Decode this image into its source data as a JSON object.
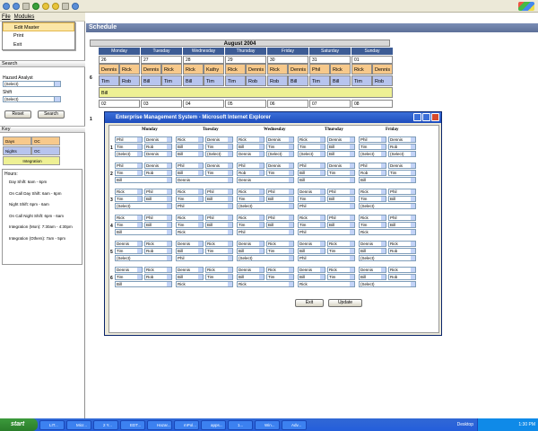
{
  "menu": {
    "file": "File",
    "modules": "Modules",
    "items": [
      "Edit Master",
      "Print",
      "Exit"
    ]
  },
  "search": {
    "section": "Search",
    "hazard_label": "Hazard Analyst",
    "hazard_value": "(Select)",
    "shift_label": "Shift",
    "shift_value": "(Select)",
    "reset": "Reset",
    "search": "Search"
  },
  "key": {
    "section": "Key",
    "rows": [
      {
        "name": "Days",
        "code": "OC"
      },
      {
        "name": "Nights",
        "code": "OC"
      },
      {
        "name": "Integration",
        "code": ""
      }
    ]
  },
  "hours": {
    "title": "Hours:",
    "items": [
      "Day Shift: 6am - 6pm",
      "On Call Day Shift: 6am - 6pm",
      "Night Shift: 6pm - 6am",
      "On Call Night Shift: 6pm - 6am",
      "Integration (Mon): 7:30am - 4:30pm",
      "Integration (Others): 7am - 5pm"
    ]
  },
  "schedule": {
    "title": "Schedule",
    "month": "August 2004",
    "days": [
      "Monday",
      "Tuesday",
      "Wednesday",
      "Thursday",
      "Friday",
      "Saturday",
      "Sunday"
    ],
    "week1_dates": [
      "26",
      "27",
      "28",
      "29",
      "30",
      "31",
      "01"
    ],
    "week1_num": "6",
    "week1_day": [
      [
        "Dennis",
        "Rick"
      ],
      [
        "Dennis",
        "Rick"
      ],
      [
        "Rick",
        "Kathy"
      ],
      [
        "Rick",
        "Dennis"
      ],
      [
        "Rick",
        "Dennis"
      ],
      [
        "Phil",
        "Rick"
      ],
      [
        "Rick",
        "Dennis"
      ]
    ],
    "week1_night": [
      [
        "Tim",
        "Rob"
      ],
      [
        "Bill",
        "Tim"
      ],
      [
        "Bill",
        "Tim"
      ],
      [
        "Tim",
        "Rob"
      ],
      [
        "Rob",
        "Bill"
      ],
      [
        "Tim",
        "Bill"
      ],
      [
        "Tim",
        "Rob"
      ]
    ],
    "week1_integ": "Bill",
    "week2_dates": [
      "02",
      "03",
      "04",
      "05",
      "06",
      "07",
      "08"
    ],
    "week2_num": "1"
  },
  "popup": {
    "title": "Enterprise Management System - Microsoft Internet Explorer",
    "days": [
      "Monday",
      "Tuesday",
      "Wednesday",
      "Thursday",
      "Friday"
    ],
    "weeks": [
      {
        "num": "1",
        "a": [
          "Phil",
          "Dennis",
          "Rick",
          "Dennis",
          "Rick",
          "Dennis",
          "Rick",
          "Dennis",
          "Phil",
          "Dennis",
          "Rick"
        ],
        "b": [
          "Tim",
          "Rob",
          "Bill",
          "Tim",
          "Bill",
          "Tim",
          "Tim",
          "Bill",
          "Tim",
          "Rob",
          "Tim"
        ],
        "c": [
          "(Select)",
          "Dennis",
          "Bill",
          "(Select)",
          "Dennis",
          "(Select)",
          "(Select)",
          "Bill",
          "(Select)",
          "(Select)",
          "Selec"
        ]
      },
      {
        "num": "2",
        "a": [
          "Phil",
          "Dennis",
          "Phil",
          "Dennis",
          "Phil",
          "Dennis",
          "Phil",
          "Dennis",
          "Phil",
          "Dennis",
          "Rick"
        ],
        "b": [
          "Tim",
          "Rob",
          "Bill",
          "Tim",
          "Rob",
          "Tim",
          "Bill",
          "Tim",
          "Rob",
          "Tim",
          "Tim"
        ],
        "c": [
          "Bill",
          "",
          "Dennis",
          "",
          "Dennis",
          "",
          "Bill",
          "",
          "Bill",
          "",
          "Selec"
        ]
      },
      {
        "num": "3",
        "a": [
          "Rick",
          "Phil",
          "Rick",
          "Phil",
          "Rick",
          "Phil",
          "Dennis",
          "Phil",
          "Rick",
          "Phil",
          "Denn"
        ],
        "b": [
          "Tim",
          "Bill",
          "Tim",
          "Bill",
          "Tim",
          "Bill",
          "Tim",
          "Bill",
          "Tim",
          "Bill",
          "Tim"
        ],
        "c": [
          "(Select)",
          "",
          "Phil",
          "",
          "(Select)",
          "",
          "Phil",
          "",
          "(Select)",
          "",
          "Selec"
        ]
      },
      {
        "num": "4",
        "a": [
          "Rick",
          "Phil",
          "Rick",
          "Phil",
          "Rick",
          "Phil",
          "Rick",
          "Phil",
          "Rick",
          "Phil",
          "Rick"
        ],
        "b": [
          "Tim",
          "Bill",
          "Tim",
          "Bill",
          "Tim",
          "Bill",
          "Tim",
          "Bill",
          "Tim",
          "Bill",
          "Tim"
        ],
        "c": [
          "Bill",
          "",
          "Rick",
          "",
          "Phil",
          "",
          "Phil",
          "",
          "Rick",
          "",
          "Bill"
        ]
      },
      {
        "num": "5",
        "a": [
          "Dennis",
          "Rick",
          "Dennis",
          "Rick",
          "Dennis",
          "Rick",
          "Dennis",
          "Rick",
          "Dennis",
          "Rick",
          "Denn"
        ],
        "b": [
          "Tim",
          "Rob",
          "Bill",
          "Tim",
          "Bill",
          "Tim",
          "Bill",
          "Tim",
          "Bill",
          "Rob",
          "Tim"
        ],
        "c": [
          "(Select)",
          "",
          "Phil",
          "",
          "(Select)",
          "",
          "Phil",
          "",
          "(Select)",
          "",
          "Selec"
        ]
      },
      {
        "num": "6",
        "a": [
          "Dennis",
          "Rick",
          "Dennis",
          "Rick",
          "Dennis",
          "Rick",
          "Dennis",
          "Rick",
          "Dennis",
          "Rick",
          "Denn"
        ],
        "b": [
          "Tim",
          "Rob",
          "Bill",
          "Tim",
          "Bill",
          "Tim",
          "Bill",
          "Tim",
          "Bill",
          "Rob",
          "Tim"
        ],
        "c": [
          "Bill",
          "",
          "Rick",
          "",
          "Rick",
          "",
          "Rick",
          "",
          "(Select)",
          "",
          "Selec"
        ]
      }
    ],
    "exit": "Exit",
    "update": "Update"
  },
  "taskbar": {
    "start": "start",
    "items": [
      "LIT...",
      "Micr...",
      "2 Y...",
      "EDT...",
      "Hazar...",
      "mPol...",
      "apps...",
      "1...",
      "Win...",
      "Adv..."
    ],
    "desktop": "Desktop",
    "time": "1:30 PM"
  }
}
